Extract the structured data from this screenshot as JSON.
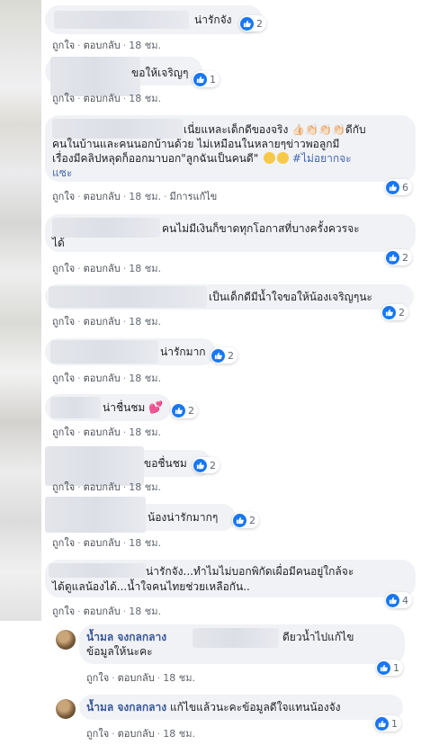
{
  "actions": {
    "like": "ถูกใจ",
    "reply": "ตอบกลับ",
    "time": "18 ชม.",
    "edited": "มีการแก้ไข"
  },
  "comments": [
    {
      "text": "น่ารักจัง",
      "reactions": "2"
    },
    {
      "text": "ขอให้เจริญๆ",
      "reactions": "1"
    },
    {
      "line1": "เนี่ยแหละเด็กดีของจริง 👍🏻👏🏻👏🏻👏🏻ดีกับ",
      "line2": "คนในบ้านและคนนอกบ้านด้วย ไม่เหมือนในหลายๆข่าวพอลูกมี",
      "line3a": "เรื่องมีคลิปหลุดก็ออกมาบอก\"ลูกฉันเป็นคนดี\" ",
      "line3tag": "#ไม่อยากจะ",
      "line4": "แซะ",
      "reactions": "6"
    },
    {
      "line1": "คนไม่มีเงินก็ขาดทุกโอกาสที่บางครั้งควรจะ",
      "line2": "ได้",
      "reactions": "2"
    },
    {
      "text": "เป็นเด็กดีมีน้ำใจขอให้น้องเจริญๆนะ",
      "reactions": "2"
    },
    {
      "text": "น่ารักมาก",
      "reactions": "2"
    },
    {
      "text": "น่าชื่นชม",
      "reactions": "2"
    },
    {
      "text": "ขอชื่นชม",
      "reactions": "2"
    },
    {
      "text": "น้องน่ารักมากๆ",
      "reactions": "2"
    },
    {
      "line1": "น่ารักจัง...ทำไมไม่บอกพิกัดเผื่อมีคนอยู่ใกล้จะ",
      "line2": "ได้ดูแลน้องได้...น้ำใจคนไทยช่วยเหลือกัน..",
      "reactions": "4"
    }
  ],
  "replies": [
    {
      "name": "น้ำมล จงกลกลาง",
      "line1": "ดียวน้ำไปแก้ไข",
      "line2": "ข้อมูลให้นะคะ",
      "reactions": "1"
    },
    {
      "name": "น้ำมล จงกลกลาง",
      "text": "แก้ไขแล้วนะคะข้อมูลดีใจแทนน้องจัง",
      "reactions": "1"
    }
  ],
  "colors": {
    "like_blue": "#1877f2",
    "bubble_bg": "#f1f2f5",
    "name_blue": "#385898"
  },
  "icons": [
    "like-icon",
    "heart-emoji",
    "smile-emoji"
  ]
}
